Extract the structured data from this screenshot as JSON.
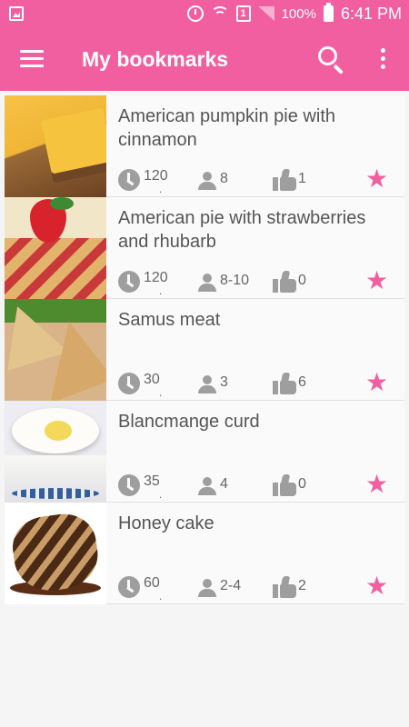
{
  "status_bar": {
    "battery_percent": "100%",
    "sim_label": "1",
    "time": "6:41 PM"
  },
  "app_bar": {
    "title": "My bookmarks",
    "bg_color": "#f15fa0"
  },
  "icons": {
    "menu": "menu-icon",
    "search": "search-icon",
    "more": "more-vert-icon",
    "time": "clock-icon",
    "servings": "person-icon",
    "likes": "thumb-up-icon",
    "bookmark": "star-icon"
  },
  "recipes": [
    {
      "title": "American pumpkin pie with cinnamon",
      "time": "120",
      "servings": "8",
      "likes": "1",
      "bookmarked": true
    },
    {
      "title": "American pie with strawberries and rhubarb",
      "time": "120",
      "servings": "8-10",
      "likes": "0",
      "bookmarked": true
    },
    {
      "title": "Samus meat",
      "time": "30",
      "servings": "3",
      "likes": "6",
      "bookmarked": true
    },
    {
      "title": "Blancmange curd",
      "time": "35",
      "servings": "4",
      "likes": "0",
      "bookmarked": true
    },
    {
      "title": "Honey cake",
      "time": "60",
      "servings": "2-4",
      "likes": "2",
      "bookmarked": true
    }
  ],
  "star_glyph": "★"
}
